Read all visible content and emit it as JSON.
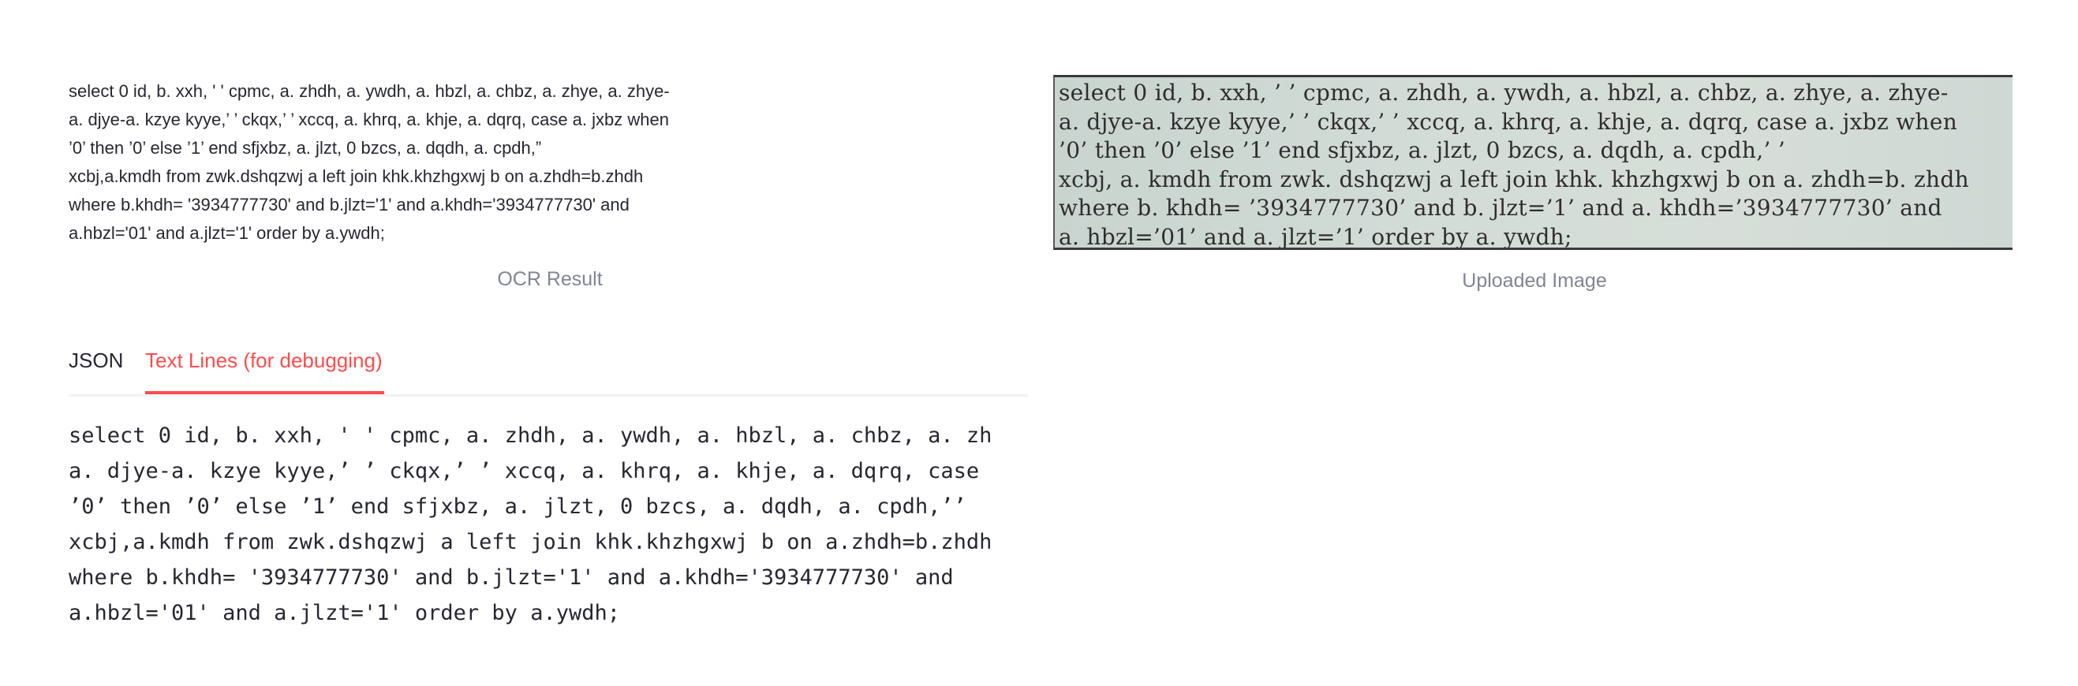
{
  "ocr_result": {
    "lines": [
      "select 0 id, b. xxh, ' ' cpmc, a. zhdh, a. ywdh, a. hbzl, a. chbz, a. zhye, a. zhye-",
      "a. djye-a. kzye kyye,’ ’ ckqx,’ ’ xccq, a. khrq, a. khje, a. dqrq, case a. jxbz when",
      "’0’ then ’0’ else ’1’ end sfjxbz, a. jlzt, 0 bzcs, a. dqdh, a. cpdh,”",
      "xcbj,a.kmdh from zwk.dshqzwj a left join khk.khzhgxwj b on a.zhdh=b.zhdh",
      "where b.khdh= '3934777730' and b.jlzt='1' and a.khdh='3934777730' and",
      "a.hbzl='01' and a.jlzt='1' order by a.ywdh;"
    ],
    "caption": "OCR Result"
  },
  "uploaded_image": {
    "lines": [
      "select 0 id, b. xxh, ’ ’ cpmc, a. zhdh, a. ywdh, a. hbzl, a. chbz, a. zhye, a. zhye-",
      "a. djye-a. kzye kyye,’ ’ ckqx,’ ’ xccq, a. khrq, a. khje, a. dqrq, case a. jxbz when",
      "’0’ then ’0’ else ’1’ end sfjxbz, a. jlzt, 0 bzcs, a. dqdh, a. cpdh,’ ’",
      "xcbj, a. kmdh from zwk. dshqzwj a left join khk. khzhgxwj b on a. zhdh=b. zhdh",
      "where b. khdh= ’3934777730’ and b. jlzt=’1’ and a. khdh=’3934777730’ and",
      "a. hbzl=’01’ and a. jlzt=’1’ order by a. ywdh;"
    ],
    "caption": "Uploaded Image"
  },
  "tabs": {
    "json_label": "JSON",
    "text_lines_label": "Text Lines (for debugging)",
    "active": "Text Lines (for debugging)"
  },
  "text_lines": [
    "select 0 id, b. xxh, ' ' cpmc, a. zhdh, a. ywdh, a. hbzl, a. chbz, a. zh",
    "a. djye-a. kzye kyye,’ ’ ckqx,’ ’ xccq, a. khrq, a. khje, a. dqrq, case",
    "’0’ then ’0’ else ’1’ end sfjxbz, a. jlzt, 0 bzcs, a. dqdh, a. cpdh,’’",
    "xcbj,a.kmdh from zwk.dshqzwj a left join khk.khzhgxwj b on a.zhdh=b.zhdh",
    "where b.khdh= '3934777730' and b.jlzt='1' and a.khdh='3934777730' and",
    "a.hbzl='01' and a.jlzt='1' order by a.ywdh;"
  ],
  "colors": {
    "accent": "#ff4b4b",
    "text": "#262730",
    "caption": "#808495"
  }
}
